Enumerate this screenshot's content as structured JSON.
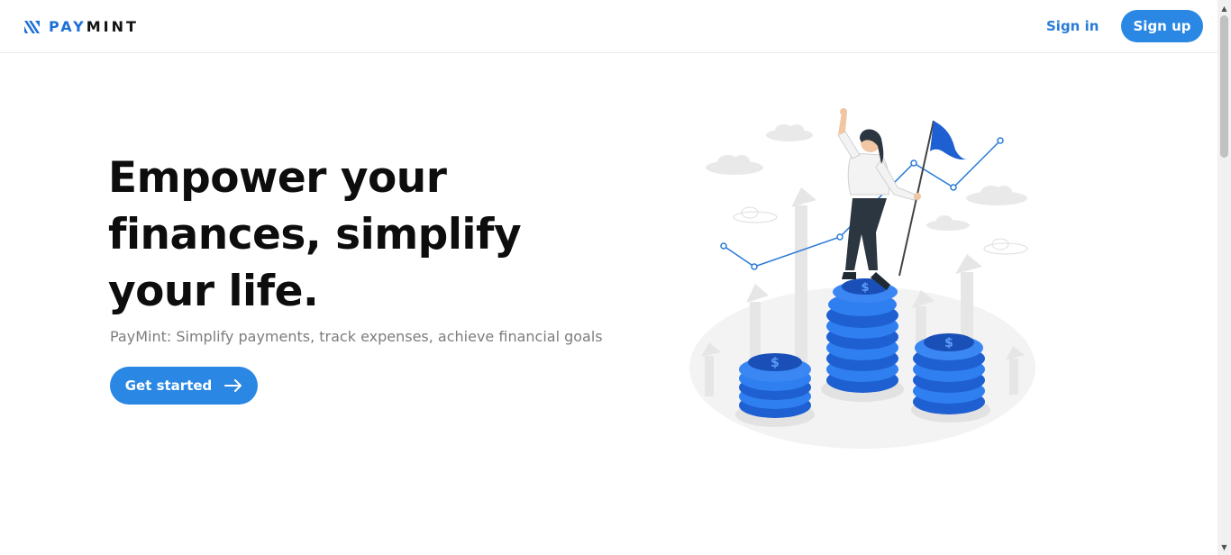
{
  "header": {
    "brand_pay": "PAY",
    "brand_mint": "MINT",
    "signin_label": "Sign in",
    "signup_label": "Sign up"
  },
  "hero": {
    "headline": "Empower your finances, simplify your life.",
    "subtitle": "PayMint: Simplify payments, track expenses, achieve financial goals",
    "cta_label": "Get started"
  },
  "icons": {
    "logo": "paymint-logo-icon",
    "cta_arrow": "arrow-right-icon",
    "illustration": "finance-growth-illustration"
  },
  "colors": {
    "accent": "#2a87e3",
    "link": "#2a7bd8",
    "brand_blue": "#1e6fd9",
    "heading": "#0d0d0d",
    "muted": "#7d7d7d"
  }
}
